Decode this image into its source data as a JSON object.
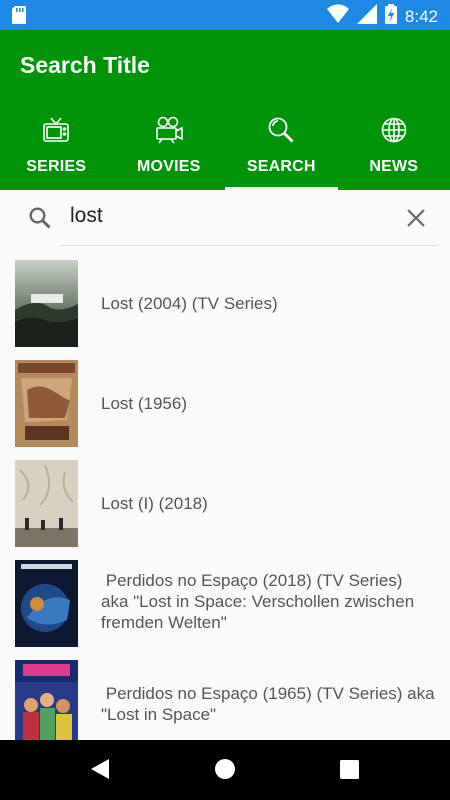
{
  "status_bar": {
    "time": "8:42",
    "icons": [
      "sd-card-icon",
      "wifi-icon",
      "signal-icon",
      "battery-charging-icon"
    ]
  },
  "app_bar": {
    "title": "Search Title",
    "background": "#00940a"
  },
  "tabs": [
    {
      "label": "SERIES",
      "icon": "tv-icon",
      "active": false
    },
    {
      "label": "MOVIES",
      "icon": "movie-camera-icon",
      "active": false
    },
    {
      "label": "SEARCH",
      "icon": "magnifier-icon",
      "active": true
    },
    {
      "label": "NEWS",
      "icon": "globe-icon",
      "active": false
    }
  ],
  "search": {
    "query": "lost"
  },
  "results": [
    {
      "title": "Lost (2004) (TV Series)"
    },
    {
      "title": "Lost (1956)"
    },
    {
      "title": "Lost (I) (2018)"
    },
    {
      "title": " Perdidos no Espaço (2018) (TV Series)\naka \"Lost in Space: Verschollen zwischen\nfremden Welten\""
    },
    {
      "title": " Perdidos no Espaço (1965) (TV Series) aka\n\"Lost in Space\""
    }
  ]
}
